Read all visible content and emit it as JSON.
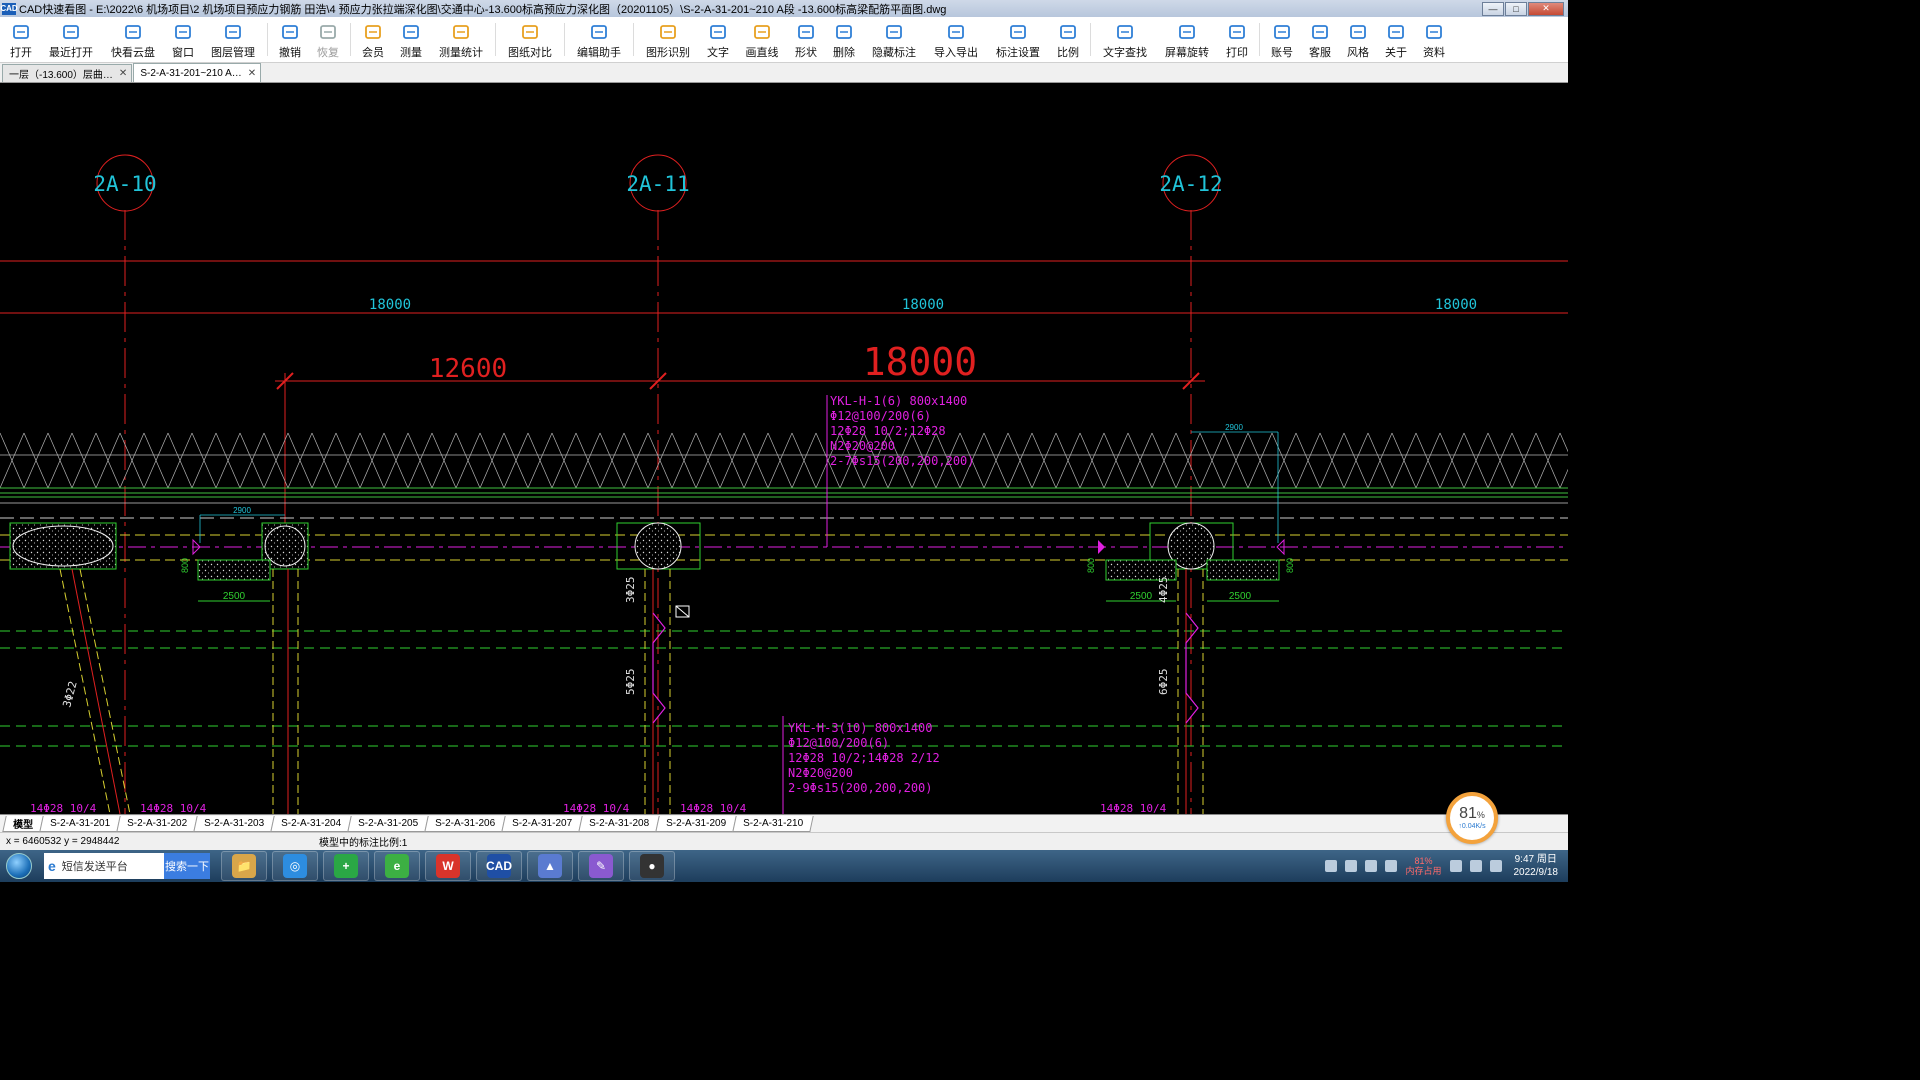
{
  "window": {
    "app_icon": "CAD",
    "title": "CAD快速看图 - E:\\2022\\6 机场项目\\2 机场项目预应力钢筋  田浩\\4 预应力张拉端深化图\\交通中心-13.600标高预应力深化图（20201105）\\S-2-A-31-201~210 A段 -13.600标高梁配筋平面图.dwg",
    "min": "—",
    "max": "□",
    "close": "✕"
  },
  "toolbar": [
    {
      "name": "open",
      "label": "打开",
      "icon": "folder-icon",
      "color": "#2f7fd6"
    },
    {
      "name": "recent",
      "label": "最近打开",
      "icon": "clock-icon",
      "color": "#2f7fd6"
    },
    {
      "name": "cloud",
      "label": "快看云盘",
      "icon": "cloud-icon",
      "color": "#2f7fd6"
    },
    {
      "name": "window",
      "label": "窗口",
      "icon": "window-icon",
      "color": "#2f7fd6"
    },
    {
      "name": "layers",
      "label": "图层管理",
      "icon": "layers-icon",
      "color": "#2f7fd6"
    },
    {
      "name": "undo",
      "label": "撤销",
      "icon": "undo-icon",
      "color": "#2f7fd6"
    },
    {
      "name": "redo",
      "label": "恢复",
      "icon": "redo-icon",
      "color": "#9aa",
      "disabled": true
    },
    {
      "name": "vip",
      "label": "会员",
      "icon": "vip-icon",
      "color": "#e8a020"
    },
    {
      "name": "measure",
      "label": "测量",
      "icon": "ruler-icon",
      "color": "#2f7fd6"
    },
    {
      "name": "measure-stats",
      "label": "测量统计",
      "icon": "stats-icon",
      "color": "#e8a020"
    },
    {
      "name": "compare",
      "label": "图纸对比",
      "icon": "compare-icon",
      "color": "#e8a020"
    },
    {
      "name": "edit-helper",
      "label": "编辑助手",
      "icon": "edit-icon",
      "color": "#2f7fd6"
    },
    {
      "name": "shape-recognize",
      "label": "图形识别",
      "icon": "shape-recognize-icon",
      "color": "#e8a020"
    },
    {
      "name": "text",
      "label": "文字",
      "icon": "text-icon",
      "color": "#2f7fd6"
    },
    {
      "name": "line",
      "label": "画直线",
      "icon": "line-icon",
      "color": "#e8a020"
    },
    {
      "name": "shape",
      "label": "形状",
      "icon": "shape-icon",
      "color": "#2f7fd6"
    },
    {
      "name": "erase",
      "label": "删除",
      "icon": "eraser-icon",
      "color": "#2f7fd6"
    },
    {
      "name": "hide-annot",
      "label": "隐藏标注",
      "icon": "eye-hide-icon",
      "color": "#2f7fd6"
    },
    {
      "name": "import-export",
      "label": "导入导出",
      "icon": "import-export-icon",
      "color": "#2f7fd6"
    },
    {
      "name": "annot-settings",
      "label": "标注设置",
      "icon": "annot-settings-icon",
      "color": "#2f7fd6"
    },
    {
      "name": "scale",
      "label": "比例",
      "icon": "scale-icon",
      "color": "#2f7fd6"
    },
    {
      "name": "find-text",
      "label": "文字查找",
      "icon": "find-icon",
      "color": "#2f7fd6"
    },
    {
      "name": "rotate",
      "label": "屏幕旋转",
      "icon": "rotate-icon",
      "color": "#2f7fd6"
    },
    {
      "name": "print",
      "label": "打印",
      "icon": "print-icon",
      "color": "#2f7fd6"
    },
    {
      "name": "account",
      "label": "账号",
      "icon": "user-icon",
      "color": "#2f7fd6"
    },
    {
      "name": "service",
      "label": "客服",
      "icon": "headset-icon",
      "color": "#2f7fd6"
    },
    {
      "name": "style",
      "label": "风格",
      "icon": "style-icon",
      "color": "#2f7fd6"
    },
    {
      "name": "about",
      "label": "关于",
      "icon": "info-icon",
      "color": "#2f7fd6"
    },
    {
      "name": "resources",
      "label": "资料",
      "icon": "resources-icon",
      "color": "#2f7fd6"
    }
  ],
  "doc_tabs": [
    {
      "label": "一层（-13.600）层曲…",
      "close": "✕",
      "active": false
    },
    {
      "label": "S-2-A-31-201~210 A…",
      "close": "✕",
      "active": true
    }
  ],
  "drawing": {
    "axis_labels": [
      "2A-10",
      "2A-11",
      "2A-12"
    ],
    "dims_top": [
      "18000",
      "18000",
      "18000"
    ],
    "dims_big": [
      "12600",
      "18000"
    ],
    "small_dims": [
      "2900",
      "2900",
      "2500",
      "2500",
      "2500",
      "800",
      "800",
      "800"
    ],
    "beam1": [
      "YKL-H-1(6) 800x1400",
      "Φ12@100/200(6)",
      "12Φ28 10/2;12Φ28",
      " N2Φ20@200",
      "2-7Φs15(200,200,200)"
    ],
    "beam2": [
      "YKL-H-3(10) 800x1400",
      "Φ12@100/200(6)",
      "12Φ28 10/2;14Φ28 2/12",
      "N2Φ20@200",
      "2-9Φs15(200,200,200)"
    ],
    "rebar_labels": [
      "3Φ25",
      "5Φ25",
      "4Φ25",
      "6Φ25",
      "3Φ22"
    ],
    "bottom_marks": [
      "14Φ28 10/4",
      "14Φ28 10/4",
      "14Φ28 10/4",
      "14Φ28 10/4",
      "14Φ28 10/4"
    ]
  },
  "layout_tabs": [
    "模型",
    "S-2-A-31-201",
    "S-2-A-31-202",
    "S-2-A-31-203",
    "S-2-A-31-204",
    "S-2-A-31-205",
    "S-2-A-31-206",
    "S-2-A-31-207",
    "S-2-A-31-208",
    "S-2-A-31-209",
    "S-2-A-31-210"
  ],
  "status": {
    "coords": "x = 6460532  y = 2948442",
    "scale_text": "模型中的标注比例:1"
  },
  "memory_widget": {
    "percent": "81",
    "unit": "%",
    "speed": "↑0.04K/s"
  },
  "taskbar": {
    "search_text": "短信发送平台",
    "search_button": "搜索一下",
    "apps": [
      {
        "name": "explorer",
        "label": "📁",
        "color": "#d8a64a"
      },
      {
        "name": "browser-360",
        "label": "◎",
        "color": "#2d8de0"
      },
      {
        "name": "add-app",
        "label": "+",
        "color": "#2aa745"
      },
      {
        "name": "ie-green",
        "label": "e",
        "color": "#3cb043"
      },
      {
        "name": "wps",
        "label": "W",
        "color": "#d9342b"
      },
      {
        "name": "cad",
        "label": "CAD",
        "color": "#1f4fa5"
      },
      {
        "name": "photo",
        "label": "▲",
        "color": "#5a7bd0"
      },
      {
        "name": "paint",
        "label": "✎",
        "color": "#8a5ad0"
      },
      {
        "name": "avatar-app",
        "label": "●",
        "color": "#333"
      }
    ],
    "mem_pct": "81%",
    "mem_label": "内存占用",
    "time": "9:47 周日",
    "date": "2022/9/18"
  }
}
